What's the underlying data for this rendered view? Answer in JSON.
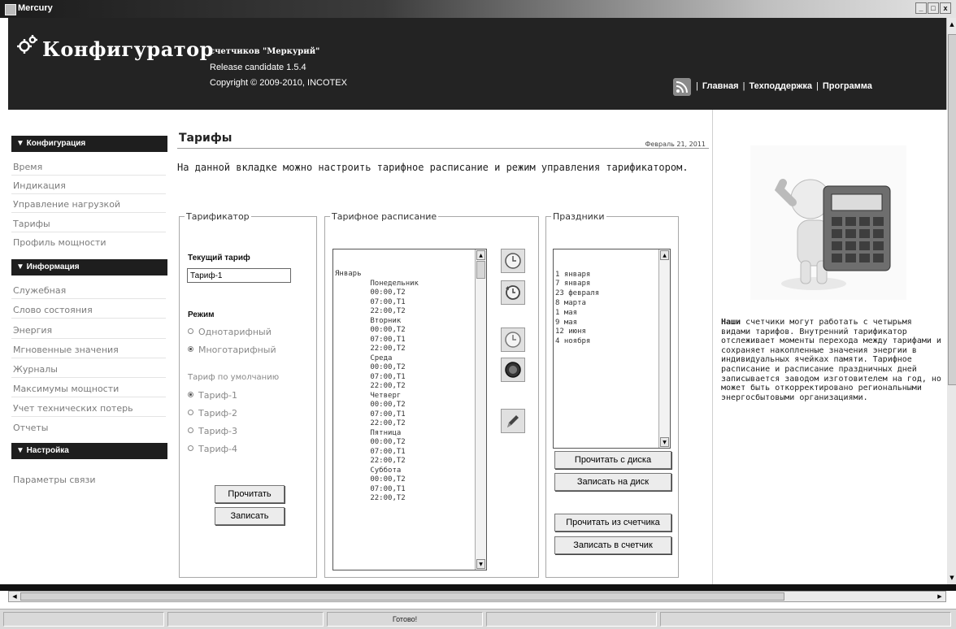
{
  "window": {
    "title": "Mercury",
    "controls": [
      "_",
      "□",
      "x"
    ]
  },
  "header": {
    "app_title": "Конфигуратор",
    "subtitle": "счетчиков \"Меркурий\"",
    "release": "Release candidate 1.5.4",
    "copyright": "Copyright © 2009-2010, INCOTEX",
    "nav": [
      "Главная",
      "Техподдержка",
      "Программа"
    ]
  },
  "sidebar": {
    "sections": [
      {
        "title": "▼ Конфигурация",
        "items": [
          "Время",
          "Индикация",
          "Управление нагрузкой",
          "Тарифы",
          "Профиль мощности"
        ]
      },
      {
        "title": "▼ Информация",
        "items": [
          "Служебная",
          "Слово состояния",
          "Энергия",
          "Мгновенные значения",
          "Журналы",
          "Максимумы мощности",
          "Учет технических потерь",
          "Отчеты"
        ]
      },
      {
        "title": "▼ Настройка",
        "items": [
          "Параметры связи"
        ]
      }
    ]
  },
  "main": {
    "title": "Тарифы",
    "date": "Февраль 21, 2011",
    "intro": "На данной вкладке можно настроить тарифное расписание и режим управления тарификатором.",
    "tariffer": {
      "legend": "Тарификатор",
      "current_label": "Текущий тариф",
      "current_value": "Тариф-1",
      "mode_label": "Режим",
      "modes": [
        "Однотарифный",
        "Многотарифный"
      ],
      "mode_selected": "Многотарифный",
      "default_label": "Тариф по умолчанию",
      "default_options": [
        "Тариф-1",
        "Тариф-2",
        "Тариф-3",
        "Тариф-4"
      ],
      "default_selected": "Тариф-1",
      "read_button": "Прочитать",
      "write_button": "Записать"
    },
    "schedule": {
      "legend": "Тарифное расписание",
      "lines": [
        "Январь",
        "        Понедельник",
        "        00:00,T2",
        "        07:00,T1",
        "        22:00,T2",
        "        Вторник",
        "        00:00,T2",
        "        07:00,T1",
        "        22:00,T2",
        "        Среда",
        "        00:00,T2",
        "        07:00,T1",
        "        22:00,T2",
        "        Четверг",
        "        00:00,T2",
        "        07:00,T1",
        "        22:00,T2",
        "        Пятница",
        "        00:00,T2",
        "        07:00,T1",
        "        22:00,T2",
        "        Суббота",
        "        00:00,T2",
        "        07:00,T1",
        "        22:00,T2"
      ],
      "icons": [
        "clock-add-icon",
        "clock-back-icon",
        "clock-icon",
        "record-icon",
        "pen-icon"
      ]
    },
    "holidays": {
      "legend": "Праздники",
      "items": [
        "1 января",
        "7 января",
        "23 февраля",
        "8 марта",
        "1 мая",
        "9 мая",
        "12 июня",
        "4 ноября"
      ],
      "btn_read_disk": "Прочитать с диска",
      "btn_write_disk": "Записать на диск",
      "btn_read_meter": "Прочитать из счетчика",
      "btn_write_meter": "Записать в счетчик"
    }
  },
  "right_panel": {
    "bold_word": "Наши",
    "text": " счетчики могут работать с четырьмя видами тарифов. Внутренний тарификатор отслеживает моменты перехода между тарифами и сохраняет накопленные значения энергии в индивидуальных ячейках памяти. Тарифное расписание и расписание праздничных дней записывается заводом изготовителем на год, но может быть откорректировано региональными энергосбытовыми организациями."
  },
  "statusbar": {
    "text": "Готово!"
  },
  "colors": {
    "header_bg": "#232323",
    "section_bg": "#1e1e1e",
    "muted_text": "#7b7b7b"
  }
}
